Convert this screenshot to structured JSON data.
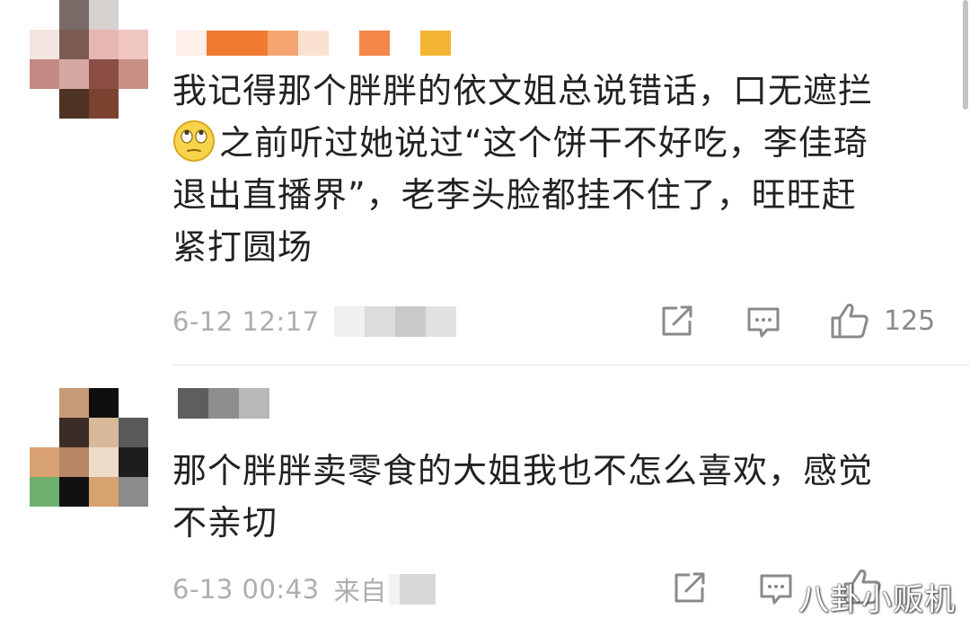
{
  "comments": [
    {
      "text_line1": "我记得那个胖胖的依文姐总说错话，口无遮拦",
      "text_line2_rest": "之前听过她说过“这个饼干不好吃，李佳琦",
      "text_line3": "退出直播界”，老李头脸都挂不住了，旺旺赶",
      "text_line4": "紧打圆场",
      "emoji": "rolling-eyes-emoji",
      "timestamp": "6-12 12:17",
      "like_count": "125"
    },
    {
      "text_line1": "那个胖胖卖零食的大姐我也不怎么喜欢，感觉",
      "text_line2": "不亲切",
      "timestamp": "6-13 00:43",
      "source_prefix": "来自"
    }
  ],
  "watermark": "八卦小贩机",
  "icons": {
    "share": "share-icon",
    "comment": "comment-icon",
    "like": "thumbs-up-icon"
  },
  "colors": {
    "meta_text": "#aeaeae",
    "body_text": "#222222",
    "divider": "#e6e6e6"
  }
}
